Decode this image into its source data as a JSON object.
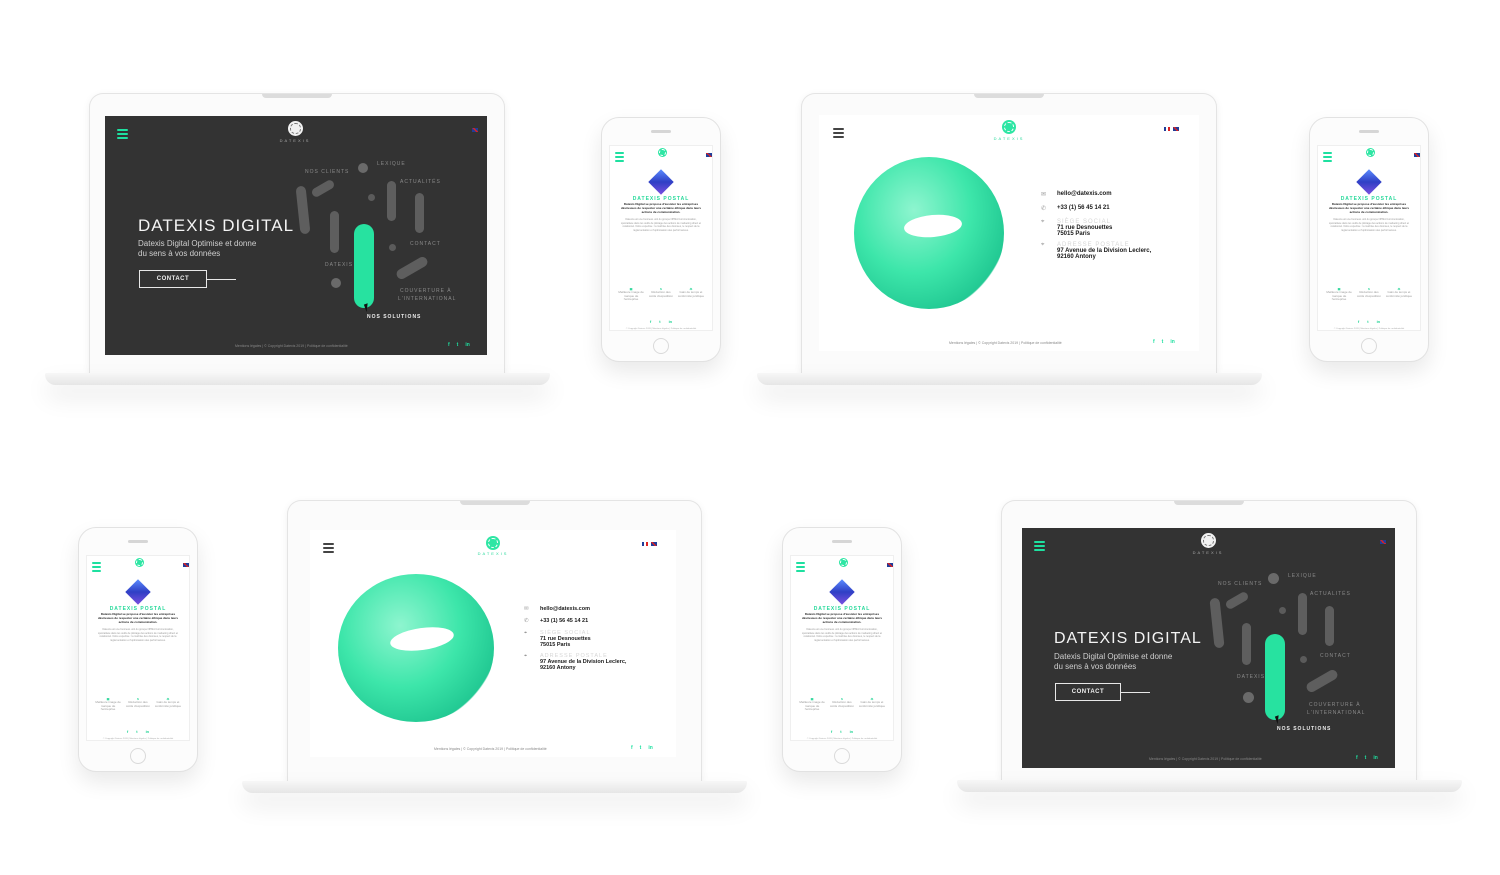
{
  "colors": {
    "accent": "#27e2a0",
    "dark": "#333333",
    "white": "#ffffff"
  },
  "brand": {
    "logo": "DATEXIS",
    "title": "DATEXIS DIGITAL",
    "subtitle_line1": "Datexis Digital Optimise et donne",
    "subtitle_line2": "du sens à vos données",
    "contact": "CONTACT"
  },
  "hero_labels": {
    "clients": "NOS CLIENTS",
    "lexique": "LEXIQUE",
    "actualites": "ACTUALITÉS",
    "contact": "CONTACT",
    "datexis": "DATEXIS",
    "couverture": "COUVERTURE À",
    "international": "L'INTERNATIONAL",
    "solutions": "NOS SOLUTIONS"
  },
  "footer": {
    "mentions": "Mentions légales",
    "copyright": "© Copyright Datexis 2019",
    "privacy": "Politique de confidentialité",
    "sep": "|"
  },
  "social": {
    "facebook": "f",
    "twitter": "t",
    "linkedin": "in"
  },
  "contact_page": {
    "email": "hello@datexis.com",
    "phone": "+33 (1) 56 45 14 21",
    "office_label": "SIÈGE SOCIAL",
    "office_street": "71 rue Desnouettes",
    "office_city": "75015 Paris",
    "postal_label": "ADRESSE POSTALE",
    "postal_street": "97 Avenue de la Division Leclerc,",
    "postal_city": "92160 Antony"
  },
  "icons": {
    "menu": "menu-icon",
    "mail": "mail-icon",
    "phone": "phone-icon",
    "location": "location-icon"
  },
  "phone_page": {
    "title": "DATEXIS POSTAL",
    "lead": "Datexis Digital se propose d'assister les entreprises désireuses de respecter une certaine éthique dans leurs actions de communication.",
    "body": "Datexis est une business unit du groupe NPMA Communication, spécialisée dans les outils de pilotage des actions de marketing direct et relationnel. Notre expertise : la maîtrise des données, le respect de la réglementation et l'optimisation des performances.",
    "features": [
      {
        "glyph": "▣",
        "label": "Meilleure image de marque de l'entreprise"
      },
      {
        "glyph": "$",
        "label": "Réduction des coûts d'expédition"
      },
      {
        "glyph": "⚖",
        "label": "Gain de temps et conformité juridique"
      }
    ],
    "footer": "© Copyright Datexis 2019 | Mentions légales | Politique de confidentialité"
  }
}
